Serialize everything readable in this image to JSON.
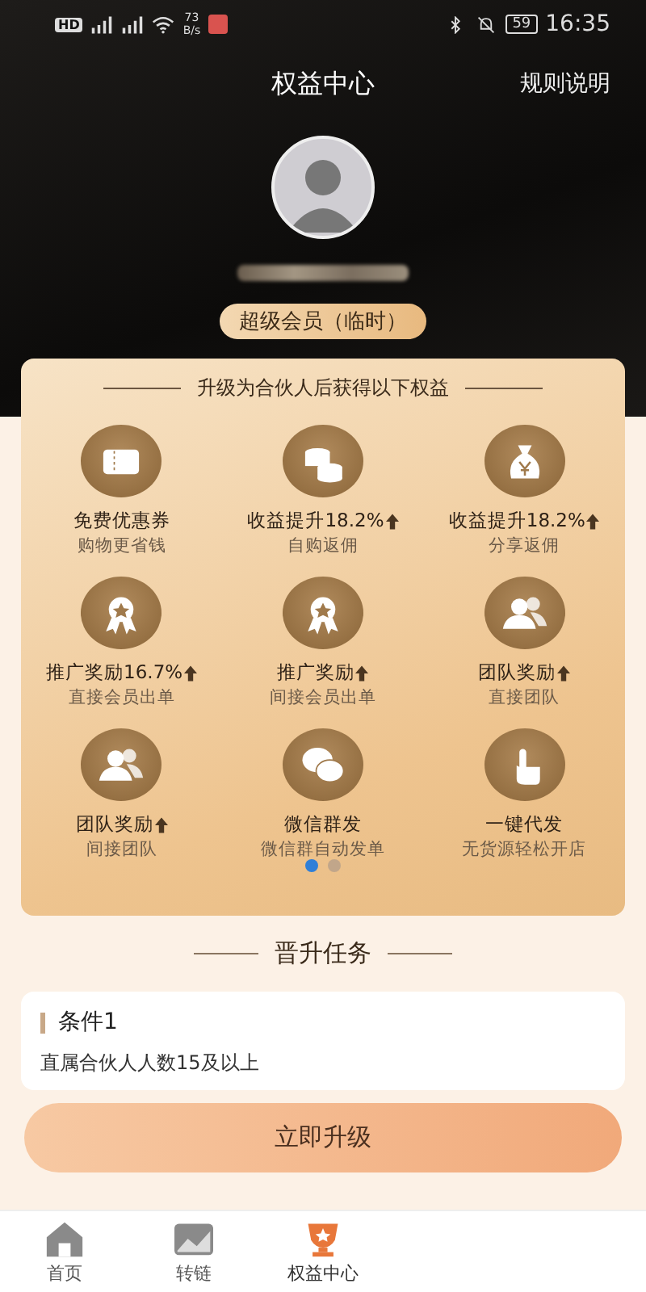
{
  "status_bar": {
    "hd_label": "HD",
    "net_speed_value": "73",
    "net_speed_unit": "B/s",
    "battery": "59",
    "time": "16:35"
  },
  "header": {
    "title": "权益中心",
    "rules_link": "规则说明"
  },
  "profile": {
    "badge": "超级会员（临时）"
  },
  "benefits": {
    "heading": "升级为合伙人后获得以下权益",
    "items": [
      {
        "kind": "ticket",
        "title": "免费优惠券",
        "boost": false,
        "subtitle": "购物更省钱"
      },
      {
        "kind": "coins",
        "title": "收益提升18.2%",
        "boost": true,
        "subtitle": "自购返佣"
      },
      {
        "kind": "moneybag",
        "title": "收益提升18.2%",
        "boost": true,
        "subtitle": "分享返佣"
      },
      {
        "kind": "medal",
        "title": "推广奖励16.7%",
        "boost": true,
        "subtitle": "直接会员出单"
      },
      {
        "kind": "medal",
        "title": "推广奖励",
        "boost": true,
        "subtitle": "间接会员出单"
      },
      {
        "kind": "team",
        "title": "团队奖励",
        "boost": true,
        "subtitle": "直接团队"
      },
      {
        "kind": "team",
        "title": "团队奖励",
        "boost": true,
        "subtitle": "间接团队"
      },
      {
        "kind": "chat",
        "title": "微信群发",
        "boost": false,
        "subtitle": "微信群自动发单"
      },
      {
        "kind": "tap",
        "title": "一键代发",
        "boost": false,
        "subtitle": "无货源轻松开店"
      }
    ],
    "pages": [
      {
        "selected": true
      },
      {
        "selected": false
      }
    ]
  },
  "tasks": {
    "heading": "晋升任务",
    "conditions": [
      {
        "title": "条件1",
        "text": "直属合伙人人数15及以上"
      }
    ]
  },
  "upgrade_button": "立即升级",
  "tabs": [
    {
      "kind": "home",
      "label": "首页",
      "selected": false
    },
    {
      "kind": "image",
      "label": "转链",
      "selected": false
    },
    {
      "kind": "trophy",
      "label": "权益中心",
      "selected": true
    }
  ]
}
